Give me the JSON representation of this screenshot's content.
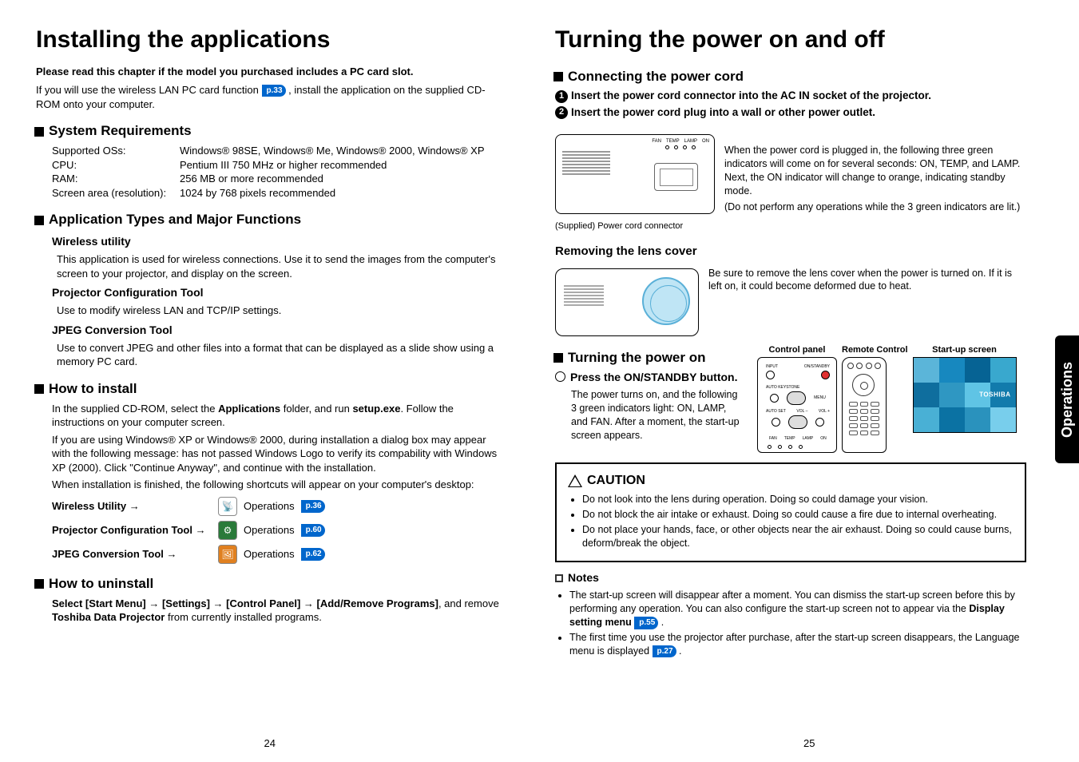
{
  "side_tab": "Operations",
  "page_left": "24",
  "page_right": "25",
  "left": {
    "title": "Installing the applications",
    "intro_bold": "Please read this chapter if the model you purchased includes a PC card slot.",
    "intro_p1a": "If you will use the wireless LAN PC card function ",
    "intro_pref": "p.33",
    "intro_p1b": " , install the application on the supplied CD-ROM onto your computer.",
    "sysreq_head": "System Requirements",
    "sysreq": {
      "os_label": "Supported OSs:",
      "os_val": "Windows® 98SE, Windows® Me, Windows® 2000, Windows® XP",
      "cpu_label": "CPU:",
      "cpu_val": "Pentium III 750 MHz or higher recommended",
      "ram_label": "RAM:",
      "ram_val": "256 MB or more recommended",
      "res_label": "Screen area (resolution):",
      "res_val": "1024 by 768 pixels recommended"
    },
    "apptypes_head": "Application Types and Major Functions",
    "wu_head": "Wireless utility",
    "wu_body": "This application is used for wireless connections. Use it to send the images from the computer's screen to your projector, and display on the screen.",
    "pct_head": "Projector Configuration Tool",
    "pct_body": "Use to modify wireless LAN and TCP/IP settings.",
    "jpeg_head": "JPEG Conversion Tool",
    "jpeg_body": "Use to convert JPEG and other files into a format that can be displayed as a slide show using a memory PC card.",
    "install_head": "How to install",
    "install_p1a": "In the supplied CD-ROM, select the ",
    "install_apps": "Applications",
    "install_p1b": " folder, and run ",
    "install_setup": "setup.exe",
    "install_p1c": ". Follow the instructions on your computer screen.",
    "install_p2": "If you are using Windows® XP or Windows® 2000, during installation a dialog box may appear with the following message: has not passed Windows Logo to verify its compability with Windows XP (2000). Click \"Continue Anyway\", and continue with the installation.",
    "install_p3": "When installation is finished, the following shortcuts will appear on your computer's desktop:",
    "shortcuts": {
      "wu": "Wireless Utility →",
      "pct": "Projector Configuration Tool →",
      "jpeg": "JPEG Conversion Tool →",
      "ops": "Operations",
      "pref_wu": "p.36",
      "pref_pct": "p.60",
      "pref_jpeg": "p.62"
    },
    "uninstall_head": "How to uninstall",
    "uninstall_body_a": "Select [Start Menu] → [Settings] → [Control Panel] → [Add/Remove Programs]",
    "uninstall_body_b": ", and remove ",
    "uninstall_body_c": "Toshiba Data Projector",
    "uninstall_body_d": " from currently installed programs."
  },
  "right": {
    "title": "Turning the power on and off",
    "connect_head": "Connecting the power cord",
    "step1": "Insert the power cord connector into the AC IN socket of the projector.",
    "step2": "Insert the power cord plug into a wall or other power outlet.",
    "ind_labels": {
      "fan": "FAN",
      "temp": "TEMP",
      "lamp": "LAMP",
      "on": "ON"
    },
    "supplied_caption": "(Supplied) Power cord connector",
    "pc_desc1": "When the power cord is plugged in, the following three green indicators will come on for several seconds: ON, TEMP, and LAMP. Next, the ON indicator will change to orange, indicating standby mode.",
    "pc_desc2": "(Do not perform any operations while the 3 green indicators are lit.)",
    "remove_head": "Removing the lens cover",
    "remove_body": "Be sure to remove the lens cover when the power is turned on. If it is left on, it could become deformed due to heat.",
    "turnon_head": "Turning the power on",
    "press_head": "Press the ON/STANDBY button.",
    "press_body": "The power turns on, and the following 3 green indicators light: ON, LAMP, and FAN. After a moment, the start-up screen appears.",
    "panel_title_cp": "Control panel",
    "panel_title_rc": "Remote Control",
    "panel_title_ss": "Start-up screen",
    "cp_labels": {
      "input": "INPUT",
      "standby": "ON/STANDBY",
      "keystone": "AUTO KEYSTONE",
      "menu": "MENU",
      "autoset": "AUTO SET",
      "voldown": "VOL –",
      "volup": "VOL +",
      "fan": "FAN",
      "temp": "TEMP",
      "lamp": "LAMP",
      "on": "ON"
    },
    "startup_brand": "TOSHIBA",
    "caution_title": "CAUTION",
    "caution_items": [
      "Do not look into the lens during operation. Doing so could damage your vision.",
      "Do not block the air intake or exhaust. Doing so could cause a fire due to internal overheating.",
      "Do not place your hands, face, or other objects near the air exhaust. Doing so could cause burns, deform/break the object."
    ],
    "notes_title": "Notes",
    "notes_items_a1": "The start-up screen will disappear after a moment. You can dismiss the start-up screen before this by performing any operation. You can also configure the start-up screen not to appear via the ",
    "notes_items_a2": "Display setting menu",
    "notes_pref1": "p.55",
    "notes_items_b1": "The first time you use the projector after purchase, after the start-up screen disappears, the Language menu is displayed ",
    "notes_pref2": "p.27"
  }
}
